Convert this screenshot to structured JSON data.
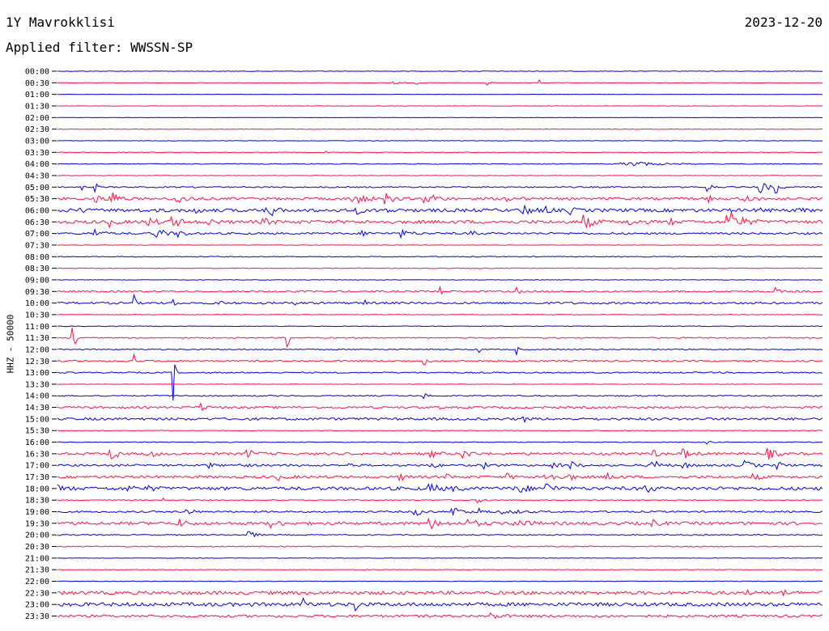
{
  "header": {
    "station": "1Y Mavrokklisi",
    "date": "2023-12-20",
    "filter": "Applied filter: WWSSN-SP"
  },
  "chart_data": {
    "type": "line",
    "title": "1Y Mavrokklisi",
    "ylabel": "HHZ - 50000",
    "colors": [
      "#0000ee",
      "#ff1044"
    ],
    "y_ticks": [
      "00:00",
      "00:30",
      "01:00",
      "01:30",
      "02:00",
      "02:30",
      "03:00",
      "03:30",
      "04:00",
      "04:30",
      "05:00",
      "05:30",
      "06:00",
      "06:30",
      "07:00",
      "07:30",
      "08:00",
      "08:30",
      "09:00",
      "09:30",
      "10:00",
      "10:30",
      "11:00",
      "11:30",
      "12:00",
      "12:30",
      "13:00",
      "13:30",
      "14:00",
      "14:30",
      "15:00",
      "15:30",
      "16:00",
      "16:30",
      "17:00",
      "17:30",
      "18:00",
      "18:30",
      "19:00",
      "19:30",
      "20:00",
      "20:30",
      "21:00",
      "21:30",
      "22:00",
      "22:30",
      "23:00",
      "23:30"
    ],
    "x_range_minutes": [
      0,
      30
    ],
    "traces": [
      {
        "noise": 0.3,
        "bursts": []
      },
      {
        "noise": 0.3,
        "bursts": [
          [
            0.44,
            3,
            6
          ],
          [
            0.47,
            2,
            4
          ],
          [
            0.56,
            4,
            4
          ],
          [
            0.63,
            5,
            2
          ]
        ]
      },
      {
        "noise": 0.2,
        "bursts": []
      },
      {
        "noise": 0.2,
        "bursts": []
      },
      {
        "noise": 0.2,
        "bursts": []
      },
      {
        "noise": 0.3,
        "bursts": []
      },
      {
        "noise": 0.3,
        "bursts": []
      },
      {
        "noise": 0.4,
        "bursts": [
          [
            0.35,
            3,
            1
          ]
        ]
      },
      {
        "noise": 0.5,
        "bursts": [
          [
            0.75,
            3,
            30
          ]
        ]
      },
      {
        "noise": 0.3,
        "bursts": []
      },
      {
        "noise": 0.8,
        "bursts": [
          [
            0.03,
            6,
            3
          ],
          [
            0.05,
            5,
            3
          ],
          [
            0.85,
            8,
            4
          ],
          [
            0.92,
            10,
            6
          ],
          [
            0.94,
            8,
            4
          ]
        ]
      },
      {
        "noise": 1.5,
        "bursts": [
          [
            0.05,
            6,
            5
          ],
          [
            0.07,
            10,
            8
          ],
          [
            0.16,
            5,
            10
          ],
          [
            0.39,
            6,
            12
          ],
          [
            0.43,
            6,
            8
          ],
          [
            0.48,
            4,
            6
          ],
          [
            0.49,
            4,
            10
          ],
          [
            0.59,
            5,
            8
          ],
          [
            0.85,
            4,
            6
          ],
          [
            0.9,
            6,
            7
          ],
          [
            0.93,
            4,
            5
          ]
        ]
      },
      {
        "noise": 2,
        "bursts": [
          [
            0.0,
            2,
            6
          ],
          [
            0.03,
            4,
            4
          ],
          [
            0.18,
            3,
            5
          ],
          [
            0.27,
            5,
            5
          ],
          [
            0.28,
            6,
            5
          ],
          [
            0.39,
            4,
            6
          ],
          [
            0.43,
            4,
            4
          ],
          [
            0.61,
            6,
            8
          ],
          [
            0.64,
            4,
            4
          ],
          [
            0.67,
            4,
            5
          ],
          [
            0.92,
            3,
            4
          ],
          [
            0.97,
            6,
            3
          ]
        ]
      },
      {
        "noise": 2,
        "bursts": [
          [
            0.07,
            5,
            6
          ],
          [
            0.12,
            5,
            7
          ],
          [
            0.15,
            6,
            10
          ],
          [
            0.2,
            4,
            5
          ],
          [
            0.27,
            5,
            5
          ],
          [
            0.69,
            8,
            8
          ],
          [
            0.75,
            3,
            8
          ],
          [
            0.8,
            5,
            4
          ],
          [
            0.88,
            12,
            12
          ]
        ]
      },
      {
        "noise": 1.2,
        "bursts": [
          [
            0.05,
            5,
            8
          ],
          [
            0.13,
            6,
            10
          ],
          [
            0.16,
            4,
            7
          ],
          [
            0.4,
            3,
            6
          ],
          [
            0.45,
            4,
            10
          ],
          [
            0.54,
            5,
            6
          ]
        ]
      },
      {
        "noise": 0.3,
        "bursts": []
      },
      {
        "noise": 0.5,
        "bursts": []
      },
      {
        "noise": 0.4,
        "bursts": [
          [
            0.55,
            3,
            2
          ]
        ]
      },
      {
        "noise": 0.3,
        "bursts": []
      },
      {
        "noise": 1,
        "bursts": [
          [
            0.5,
            8,
            2
          ],
          [
            0.6,
            10,
            2
          ],
          [
            0.94,
            4,
            4
          ]
        ]
      },
      {
        "noise": 1.3,
        "bursts": [
          [
            0.1,
            10,
            2
          ],
          [
            0.15,
            10,
            2
          ],
          [
            0.21,
            10,
            2
          ],
          [
            0.31,
            10,
            2
          ],
          [
            0.4,
            8,
            2
          ]
        ]
      },
      {
        "noise": 0.4,
        "bursts": []
      },
      {
        "noise": 0.4,
        "bursts": []
      },
      {
        "noise": 0.7,
        "bursts": [
          [
            0.02,
            40,
            1
          ],
          [
            0.3,
            30,
            1
          ]
        ]
      },
      {
        "noise": 0.6,
        "bursts": [
          [
            0.55,
            8,
            2
          ],
          [
            0.6,
            6,
            2
          ]
        ]
      },
      {
        "noise": 1,
        "bursts": [
          [
            0.1,
            20,
            1
          ],
          [
            0.48,
            4,
            4
          ],
          [
            0.53,
            5,
            3
          ]
        ]
      },
      {
        "noise": 0.8,
        "bursts": [
          [
            0.15,
            60,
            1
          ]
        ]
      },
      {
        "noise": 0.3,
        "bursts": []
      },
      {
        "noise": 0.8,
        "bursts": [
          [
            0.48,
            3,
            4
          ]
        ]
      },
      {
        "noise": 1.2,
        "bursts": [
          [
            0.19,
            4,
            6
          ],
          [
            0.5,
            3,
            2
          ]
        ]
      },
      {
        "noise": 1.5,
        "bursts": [
          [
            0.61,
            3,
            3
          ]
        ]
      },
      {
        "noise": 0.4,
        "bursts": []
      },
      {
        "noise": 0.5,
        "bursts": [
          [
            0.85,
            2,
            4
          ]
        ]
      },
      {
        "noise": 1.5,
        "bursts": [
          [
            0.07,
            10,
            6
          ],
          [
            0.12,
            5,
            6
          ],
          [
            0.25,
            4,
            8
          ],
          [
            0.49,
            4,
            6
          ],
          [
            0.53,
            5,
            8
          ],
          [
            0.78,
            4,
            6
          ],
          [
            0.82,
            5,
            8
          ],
          [
            0.93,
            6,
            8
          ]
        ]
      },
      {
        "noise": 1.2,
        "bursts": [
          [
            0.2,
            3,
            5
          ],
          [
            0.24,
            3,
            6
          ],
          [
            0.38,
            2,
            8
          ],
          [
            0.49,
            3,
            6
          ],
          [
            0.56,
            4,
            6
          ],
          [
            0.65,
            3,
            10
          ],
          [
            0.67,
            4,
            10
          ],
          [
            0.78,
            6,
            8
          ],
          [
            0.82,
            3,
            8
          ],
          [
            0.9,
            5,
            8
          ],
          [
            0.94,
            6,
            6
          ]
        ]
      },
      {
        "noise": 1.5,
        "bursts": [
          [
            0.29,
            3,
            8
          ],
          [
            0.45,
            3,
            8
          ],
          [
            0.51,
            3,
            4
          ],
          [
            0.59,
            3,
            6
          ],
          [
            0.64,
            6,
            8
          ],
          [
            0.67,
            4,
            5
          ],
          [
            0.72,
            4,
            8
          ],
          [
            0.91,
            3,
            10
          ]
        ]
      },
      {
        "noise": 2,
        "bursts": [
          [
            0.0,
            3,
            8
          ],
          [
            0.09,
            5,
            6
          ],
          [
            0.12,
            3,
            6
          ],
          [
            0.49,
            4,
            10
          ],
          [
            0.52,
            3,
            6
          ],
          [
            0.6,
            8,
            8
          ],
          [
            0.64,
            6,
            8
          ],
          [
            0.77,
            6,
            6
          ]
        ]
      },
      {
        "noise": 0.6,
        "bursts": [
          [
            0.14,
            2,
            4
          ],
          [
            0.55,
            4,
            6
          ]
        ]
      },
      {
        "noise": 1,
        "bursts": [
          [
            0.17,
            5,
            6
          ],
          [
            0.47,
            4,
            8
          ],
          [
            0.52,
            5,
            10
          ],
          [
            0.55,
            4,
            8
          ],
          [
            0.59,
            2,
            20
          ]
        ]
      },
      {
        "noise": 1.8,
        "bursts": [
          [
            0.16,
            4,
            8
          ],
          [
            0.28,
            4,
            10
          ],
          [
            0.49,
            5,
            10
          ],
          [
            0.54,
            4,
            10
          ],
          [
            0.6,
            4,
            12
          ],
          [
            0.78,
            3,
            8
          ]
        ]
      },
      {
        "noise": 0.7,
        "bursts": [
          [
            0.25,
            6,
            6
          ]
        ]
      },
      {
        "noise": 0.6,
        "bursts": []
      },
      {
        "noise": 0.3,
        "bursts": []
      },
      {
        "noise": 0.3,
        "bursts": []
      },
      {
        "noise": 0.4,
        "bursts": []
      },
      {
        "noise": 2,
        "bursts": [
          [
            0.9,
            4,
            3
          ],
          [
            0.95,
            3,
            3
          ]
        ]
      },
      {
        "noise": 2.2,
        "bursts": [
          [
            0.32,
            8,
            4
          ],
          [
            0.39,
            8,
            3
          ]
        ]
      },
      {
        "noise": 1.5,
        "bursts": [
          [
            0.57,
            3,
            10
          ]
        ]
      }
    ]
  }
}
